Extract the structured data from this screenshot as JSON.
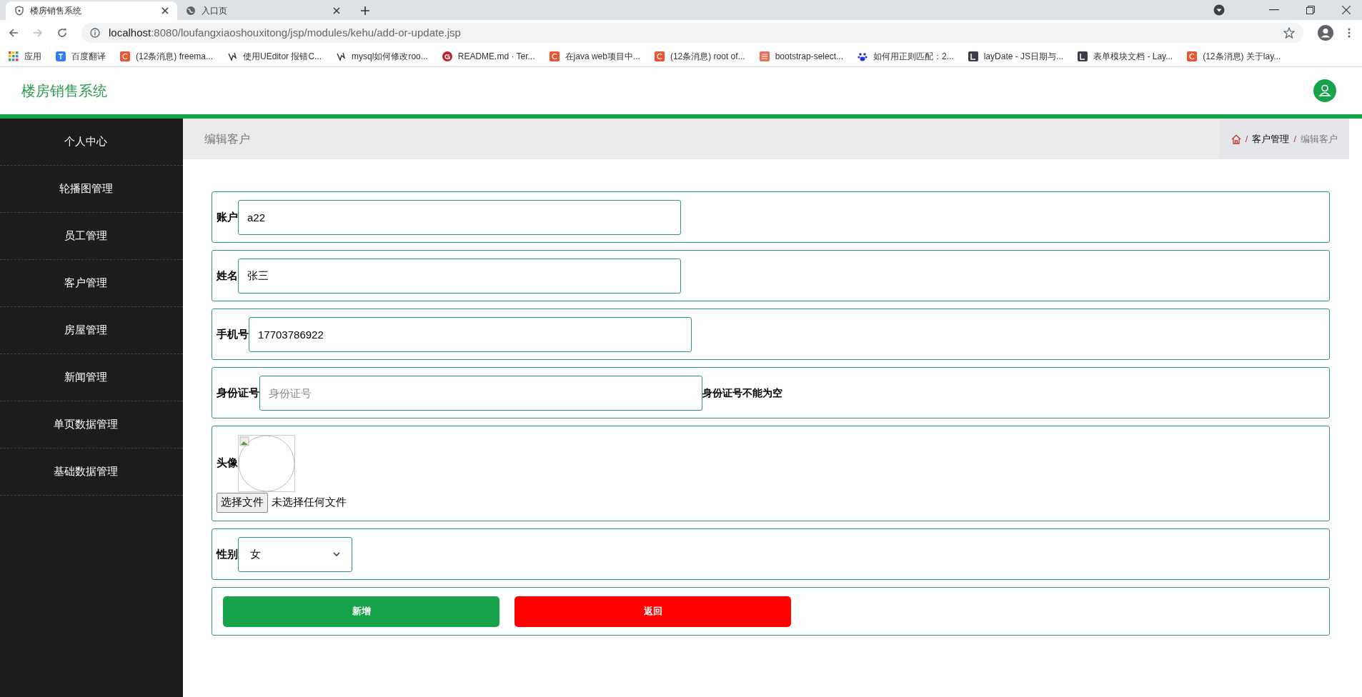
{
  "browser": {
    "tabs": [
      {
        "title": "楼房销售系统",
        "selected": true
      },
      {
        "title": "入口页",
        "selected": false
      }
    ],
    "url": "localhost:8080/loufangxiaoshouxitong/jsp/modules/kehu/add-or-update.jsp",
    "bookmarks": [
      {
        "label": "应用",
        "kind": "apps"
      },
      {
        "label": "百度翻译",
        "kind": "translate"
      },
      {
        "label": "(12条消息) freema...",
        "kind": "csdn"
      },
      {
        "label": "使用UEditor 报错C...",
        "kind": "ueditor"
      },
      {
        "label": "mysql如何修改roo...",
        "kind": "ueditor"
      },
      {
        "label": "README.md · Ter...",
        "kind": "gitee"
      },
      {
        "label": "在java web项目中...",
        "kind": "csdn"
      },
      {
        "label": "(12条消息) root of...",
        "kind": "csdn"
      },
      {
        "label": "bootstrap-select...",
        "kind": "jianshu"
      },
      {
        "label": "如何用正则匹配：2...",
        "kind": "baidu"
      },
      {
        "label": "layDate - JS日期与...",
        "kind": "layui"
      },
      {
        "label": "表单模块文档 - Lay...",
        "kind": "layui"
      },
      {
        "label": "(12条消息) 关于lay...",
        "kind": "csdn"
      }
    ]
  },
  "app": {
    "title": "楼房销售系统"
  },
  "sidebar": {
    "items": [
      {
        "label": "个人中心"
      },
      {
        "label": "轮播图管理"
      },
      {
        "label": "员工管理"
      },
      {
        "label": "客户管理"
      },
      {
        "label": "房屋管理"
      },
      {
        "label": "新闻管理"
      },
      {
        "label": "单页数据管理"
      },
      {
        "label": "基础数据管理"
      }
    ]
  },
  "page_header": {
    "title": "编辑客户",
    "separator": "/",
    "breadcrumb": [
      "客户管理",
      "编辑客户"
    ]
  },
  "form": {
    "fields": [
      {
        "kind": "text",
        "label": "账户",
        "value": "a22"
      },
      {
        "kind": "text",
        "label": "姓名",
        "value": "张三"
      },
      {
        "kind": "text",
        "label": "手机号",
        "value": "17703786922"
      },
      {
        "kind": "text",
        "label": "身份证号",
        "placeholder": "身份证号",
        "error": "身份证号不能为空"
      },
      {
        "kind": "image",
        "label": "头像",
        "button": "选择文件",
        "status": "未选择任何文件"
      },
      {
        "kind": "select",
        "label": "性别",
        "value": "女"
      }
    ],
    "buttons": [
      {
        "label": "新增",
        "kind": "primary"
      },
      {
        "label": "返回",
        "kind": "danger"
      }
    ]
  }
}
